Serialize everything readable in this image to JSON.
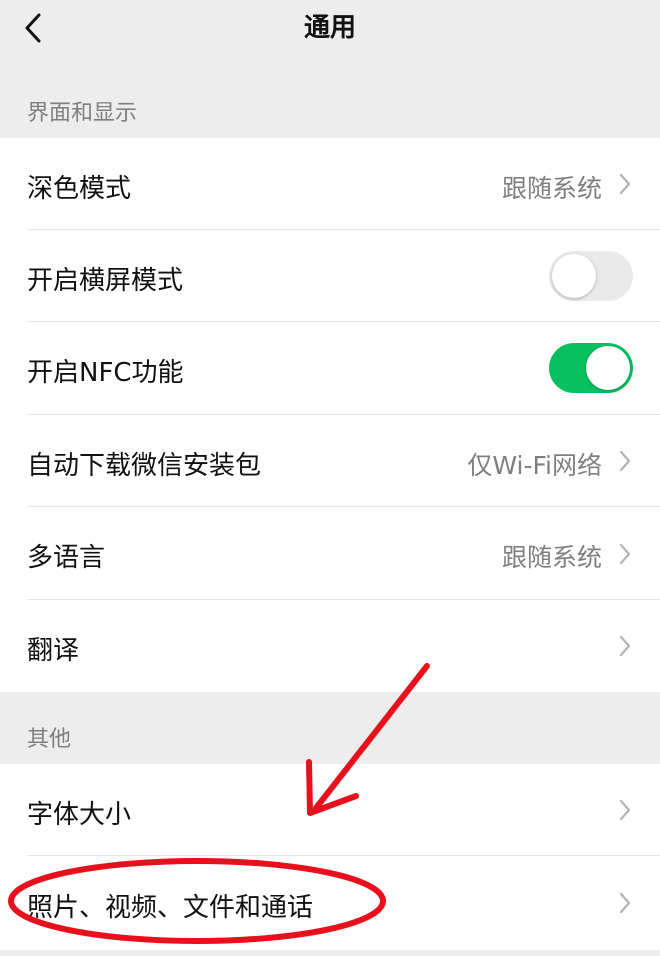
{
  "navbar": {
    "title": "通用",
    "back_icon": "chevron-left-icon"
  },
  "sections": {
    "display": {
      "header": "界面和显示",
      "dark_mode": {
        "label": "深色模式",
        "value": "跟随系统"
      },
      "landscape": {
        "label": "开启横屏模式",
        "enabled": false
      },
      "nfc": {
        "label": "开启NFC功能",
        "enabled": true
      },
      "auto_download": {
        "label": "自动下载微信安装包",
        "value": "仅Wi-Fi网络"
      },
      "language": {
        "label": "多语言",
        "value": "跟随系统"
      },
      "translate": {
        "label": "翻译"
      }
    },
    "other": {
      "header": "其他",
      "font_size": {
        "label": "字体大小"
      },
      "media_files": {
        "label": "照片、视频、文件和通话"
      }
    }
  },
  "colors": {
    "toggle_on": "#07c160",
    "toggle_off": "#e9e9ea",
    "annotation": "#e8101c",
    "background": "#ededed"
  }
}
